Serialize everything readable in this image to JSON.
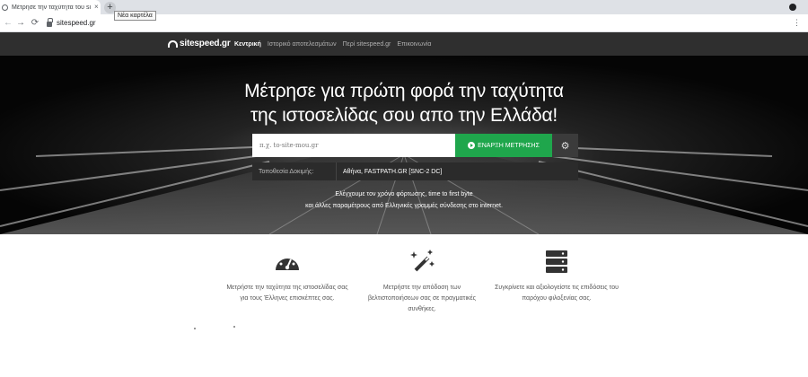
{
  "browser": {
    "tab_title": "Μέτρησε την ταχύτητα του site",
    "tab_close": "×",
    "newtab_glyph": "+",
    "tooltip": "Νέα καρτέλα",
    "back_glyph": "←",
    "forward_glyph": "→",
    "reload_glyph": "⟳",
    "url": "sitespeed.gr",
    "menu_glyph": "⋮"
  },
  "navbar": {
    "logo_text": "sitespeed.gr",
    "links": [
      {
        "label": "Κεντρική",
        "active": true
      },
      {
        "label": "Ιστορικό αποτελεσμάτων",
        "active": false
      },
      {
        "label": "Περί sitespeed.gr",
        "active": false
      },
      {
        "label": "Επικοινωνία",
        "active": false
      }
    ]
  },
  "hero": {
    "title_line1": "Μέτρησε για πρώτη φορά την ταχύτητα",
    "title_line2": "της ιστοσελίδας σου απο την Ελλάδα!",
    "input_placeholder": "π.χ. to-site-mou.gr",
    "start_button": "ΕΝΑΡΞΗ ΜΕΤΡΗΣΗΣ",
    "settings_glyph": "⚙",
    "location_label": "Τοποθεσία Δοκιμής:",
    "location_value": "Αθήνα, FASTPATH.GR [SNC-2 DC]",
    "subtitle_line1": "Ελέγχουμε τον χρόνο φόρτωσης, time to first byte",
    "subtitle_line2": "και άλλες παραμέτρους από Ελληνικές γραμμές σύνδεσης στο internet."
  },
  "features": [
    {
      "icon": "speedometer-icon",
      "text": "Μετρήστε την ταχύτητα της ιστοσελίδας σας για τους Έλληνες επισκέπτες σας."
    },
    {
      "icon": "magic-wand-icon",
      "text": "Μετρήστε την απόδοση των βελτιστοποιήσεων σας σε πραγματικές συνθήκες."
    },
    {
      "icon": "server-icon",
      "text": "Συγκρίνετε και αξιολογείστε τις επιδόσεις του παρόχου φιλοξενίας σας."
    }
  ],
  "colors": {
    "navbar_bg": "#2f2f2f",
    "accent_green": "#1fa64c",
    "hero_bg": "#060606"
  }
}
